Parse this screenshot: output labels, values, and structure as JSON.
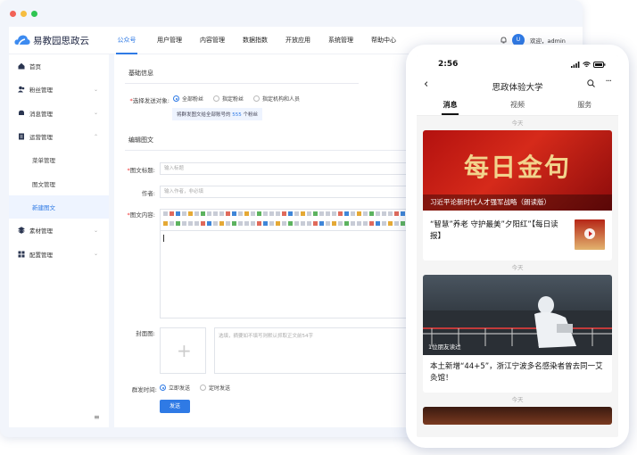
{
  "window": {
    "dots": [
      "#f26257",
      "#f6bd40",
      "#2fc552"
    ]
  },
  "brand": {
    "name": "易教园思政云",
    "accent": "#2f7ae5"
  },
  "top_nav": [
    "公众号",
    "用户管理",
    "内容管理",
    "数据指数",
    "开放应用",
    "系统管理",
    "帮助中心"
  ],
  "user": {
    "avatar_letter": "U",
    "greeting": "欢迎，admin"
  },
  "sidebar": {
    "items": [
      {
        "label": "首页",
        "icon": "home-icon",
        "chevron": ""
      },
      {
        "label": "粉丝管理",
        "icon": "users-icon",
        "chevron": "⌄"
      },
      {
        "label": "消息管理",
        "icon": "bell-icon",
        "chevron": "⌄"
      },
      {
        "label": "运营管理",
        "icon": "doc-icon",
        "chevron": "⌃"
      },
      {
        "label": "菜单管理",
        "sub": true
      },
      {
        "label": "图文管理",
        "sub": true
      },
      {
        "label": "新建图文",
        "sub": true,
        "active": true
      },
      {
        "label": "素材管理",
        "icon": "layers-icon",
        "chevron": "⌄"
      },
      {
        "label": "配置管理",
        "icon": "grid-icon",
        "chevron": "⌄"
      }
    ],
    "collapse_icon": "≡"
  },
  "form": {
    "basic_title": "基础信息",
    "target_label": "选择发送对象:",
    "target_options": [
      "全部粉丝",
      "指定粉丝",
      "指定机构和人员"
    ],
    "target_hint_prefix": "将群发图文给全部账号的",
    "target_hint_count": "555",
    "target_hint_suffix": "个粉丝",
    "edit_title": "编辑图文",
    "title_label": "图文标题:",
    "title_placeholder": "输入标题",
    "author_label": "作者:",
    "author_placeholder": "输入作者，非必填",
    "content_label": "图文内容:",
    "cover_label": "封面图:",
    "summary_placeholder": "选填，摘要如不填写则默认抓取正文前54字",
    "time_label": "群发时间:",
    "time_options": [
      "立即发送",
      "定时发送"
    ],
    "send_label": "发送"
  },
  "phone": {
    "time": "2:56",
    "title": "思政体验大学",
    "tabs": [
      "消息",
      "视频",
      "服务"
    ],
    "day_label": "今天",
    "card1": {
      "hero_text": "每日金句",
      "caption": "习近平论新时代人才强军战略（朗读版）",
      "item": "“智慧”养老 守护最美”夕阳红”【每日读报】"
    },
    "card2": {
      "caption": "1位朋友读过",
      "title": "本土新增“44+5”，浙江宁波多名感染者曾去同一艾灸馆！"
    }
  }
}
